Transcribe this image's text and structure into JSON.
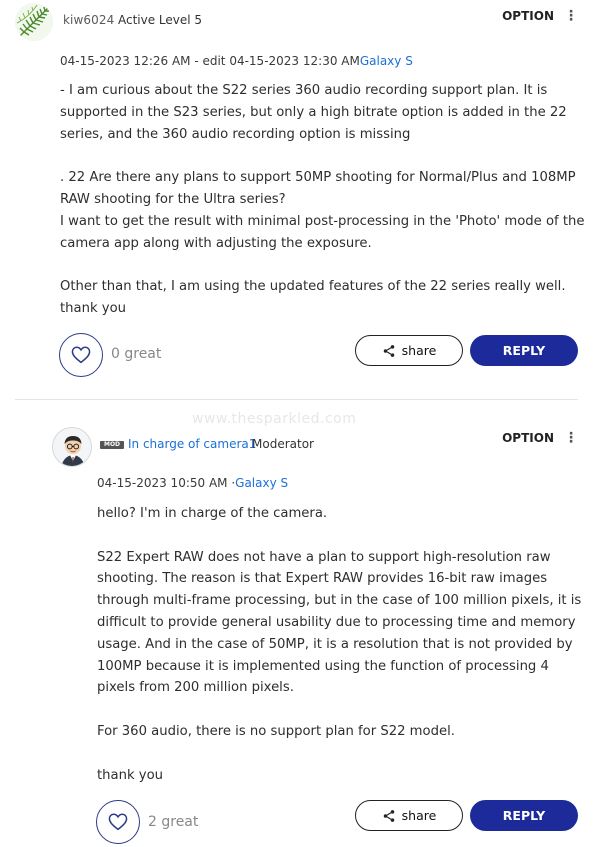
{
  "watermark": "www.thesparkled.com",
  "posts": [
    {
      "author": "kiw6024",
      "rank": "Active Level 5",
      "option_label": "OPTION",
      "meta": "04-15-2023 12:26 AM - edit 04-15-2023 12:30 AM",
      "board": "Galaxy S",
      "paragraphs": [
        "- I am curious about the S22 series 360 audio recording support plan. It is supported in the S23 series, but only a high bitrate option is added in the 22 series, and the 360 audio recording option is missing",
        ". 22 Are there any plans to support 50MP shooting for Normal/Plus and 108MP RAW shooting for the Ultra series?\nI want to get the result with minimal post-processing in the 'Photo' mode of the camera app along with adjusting the exposure.",
        "Other than that, I am using the updated features of the 22 series really well. thank you"
      ],
      "likes": "0 great",
      "share_label": "share",
      "reply_label": "REPLY"
    },
    {
      "badge": "MOD",
      "author": "In charge of camera1",
      "rank": "Moderator",
      "option_label": "OPTION",
      "meta": "04-15-2023 10:50 AM ·",
      "board": "Galaxy S",
      "paragraphs": [
        "hello? I'm in charge of the camera.",
        "S22 Expert RAW does not have a plan to support high-resolution raw shooting. The reason is that Expert RAW provides 16-bit raw images through multi-frame processing, but in the case of 100 million pixels, it is difficult to provide general usability due to processing time and memory usage. And in the case of 50MP, it is a resolution that is not provided by 100MP because it is implemented using the function of processing 4 pixels from 200 million pixels.",
        "For 360 audio, there is no support plan for S22 model.",
        "thank you"
      ],
      "likes": "2 great",
      "share_label": "share",
      "reply_label": "REPLY"
    }
  ],
  "icons": {
    "heart": "heart-icon",
    "share": "share-icon",
    "kebab": "kebab-menu-icon"
  },
  "colors": {
    "accent": "#1d2b9a",
    "link": "#1c6fd6"
  }
}
